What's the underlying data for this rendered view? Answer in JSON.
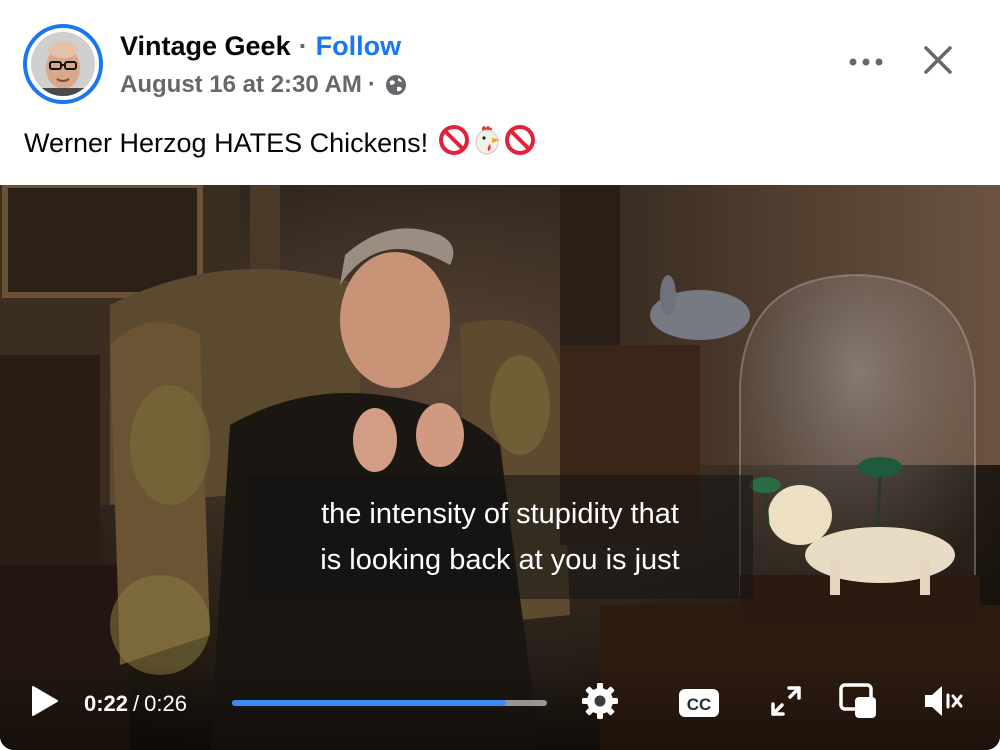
{
  "post": {
    "author": "Vintage Geek",
    "separator": "·",
    "follow_label": "Follow",
    "date": "August 16 at 2:30 AM",
    "meta_separator": "·",
    "privacy_icon": "globe-icon",
    "more_icon": "more-horizontal-icon",
    "close_icon": "close-icon",
    "caption": "Werner Herzog HATES Chickens!",
    "caption_emojis": [
      "prohibited-icon",
      "chicken-icon",
      "prohibited-icon"
    ]
  },
  "video": {
    "subtitles": [
      "the intensity of stupidity that",
      "is looking back at you is just"
    ],
    "current_time": "0:22",
    "time_separator": "/",
    "duration": "0:26",
    "progress": 0.87,
    "controls": {
      "play_icon": "play-icon",
      "settings_icon": "gear-icon",
      "captions_label": "CC",
      "fullscreen_icon": "fullscreen-icon",
      "pip_icon": "picture-in-picture-icon",
      "mute_icon": "muted-speaker-icon"
    }
  },
  "colors": {
    "brand_blue": "#1877f2",
    "secondary_text": "#65676b",
    "progress_fill": "#3a8bf5"
  }
}
